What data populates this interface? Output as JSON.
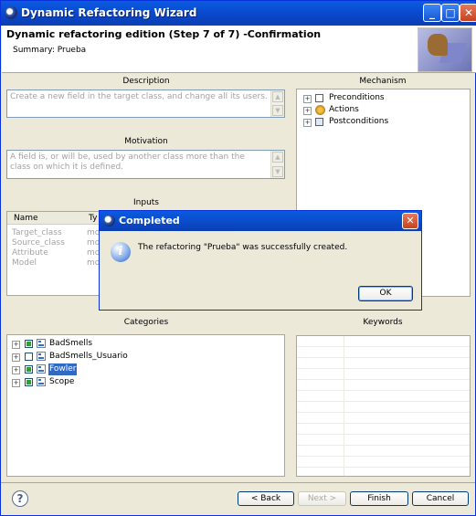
{
  "window": {
    "title": "Dynamic Refactoring Wizard"
  },
  "header": {
    "title": "Dynamic refactoring edition (Step 7 of 7) -Confirmation",
    "summary": "Summary: Prueba"
  },
  "description": {
    "label": "Description",
    "value": "Create a new field in the target class, and change all its users."
  },
  "motivation": {
    "label": "Motivation",
    "value": "A field is, or will be, used by another class more than the class on which it is defined."
  },
  "inputs": {
    "label": "Inputs",
    "columns": [
      "Name",
      "Ty"
    ],
    "rows": [
      [
        "Target_class",
        "mo"
      ],
      [
        "Source_class",
        "mo"
      ],
      [
        "Attribute",
        "mo"
      ],
      [
        "Model",
        "mo"
      ]
    ]
  },
  "mechanism": {
    "label": "Mechanism",
    "items": [
      "Preconditions",
      "Actions",
      "Postconditions"
    ]
  },
  "categories": {
    "label": "Categories",
    "items": [
      {
        "label": "BadSmells",
        "checked": true
      },
      {
        "label": "BadSmells_Usuario",
        "checked": false
      },
      {
        "label": "Fowler",
        "checked": true,
        "selected": true
      },
      {
        "label": "Scope",
        "checked": true
      }
    ]
  },
  "keywords": {
    "label": "Keywords"
  },
  "dialog": {
    "title": "Completed",
    "message": "The refactoring \"Prueba\" was successfully created.",
    "ok": "OK"
  },
  "buttons": {
    "back": "< Back",
    "next": "Next >",
    "finish": "Finish",
    "cancel": "Cancel"
  }
}
